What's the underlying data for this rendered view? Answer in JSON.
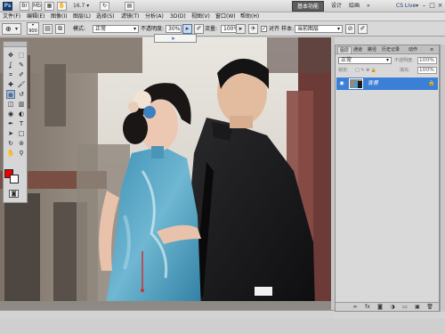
{
  "app": {
    "logo": "Ps",
    "zoom": "16.7",
    "workspace_active": "基本功能",
    "workspace_links": [
      "设计",
      "绘画",
      "»"
    ],
    "cslive": "CS Live▾",
    "window_controls": [
      "–",
      "□",
      "×"
    ]
  },
  "menu": [
    "文件(F)",
    "编辑(E)",
    "图像(I)",
    "图层(L)",
    "选择(S)",
    "滤镜(T)",
    "分析(A)",
    "3D(D)",
    "视图(V)",
    "窗口(W)",
    "帮助(H)"
  ],
  "options": {
    "brush_size": "900",
    "mode_label": "模式:",
    "mode_value": "正常",
    "opacity_label": "不透明度:",
    "opacity_value": "30%",
    "flow_label": "流量:",
    "flow_value": "100%",
    "align_label": "对齐",
    "sample_label": "样本:",
    "sample_value": "当前图层"
  },
  "tools": {
    "icons": [
      "move-icon",
      "marquee-icon",
      "lasso-icon",
      "quick-select-icon",
      "crop-icon",
      "eyedropper-icon",
      "healing-icon",
      "brush-icon",
      "clone-stamp-icon",
      "history-brush-icon",
      "eraser-icon",
      "gradient-icon",
      "blur-icon",
      "dodge-icon",
      "pen-icon",
      "type-icon",
      "path-select-icon",
      "shape-icon",
      "3d-rotate-icon",
      "3d-camera-icon",
      "hand-icon",
      "zoom-icon"
    ],
    "glyphs": [
      "✥",
      "⬚",
      "ʆ",
      "✎",
      "⌗",
      "✐",
      "✚",
      "🖌",
      "⊕",
      "↺",
      "◫",
      "▥",
      "◉",
      "◐",
      "✒",
      "T",
      "➤",
      "□",
      "↻",
      "⊚",
      "✋",
      "⚲"
    ],
    "fg_color": "#ee0000",
    "bg_color": "#ffffff"
  },
  "layers": {
    "tabs": [
      "图层",
      "通道",
      "路径",
      "历史记录",
      "动作"
    ],
    "blend_mode": "正常",
    "opacity_label": "不透明度:",
    "opacity_value": "100%",
    "fill_label": "填充:",
    "fill_value": "100%",
    "lock_label": "锁定:",
    "layer_name": "背景",
    "footer_icons": [
      "link-icon",
      "fx-icon",
      "mask-icon",
      "adjustment-icon",
      "group-icon",
      "new-layer-icon",
      "trash-icon"
    ],
    "footer_glyphs": [
      "∞",
      "fx",
      "◙",
      "◑",
      "▭",
      "▣",
      "🗑"
    ]
  }
}
